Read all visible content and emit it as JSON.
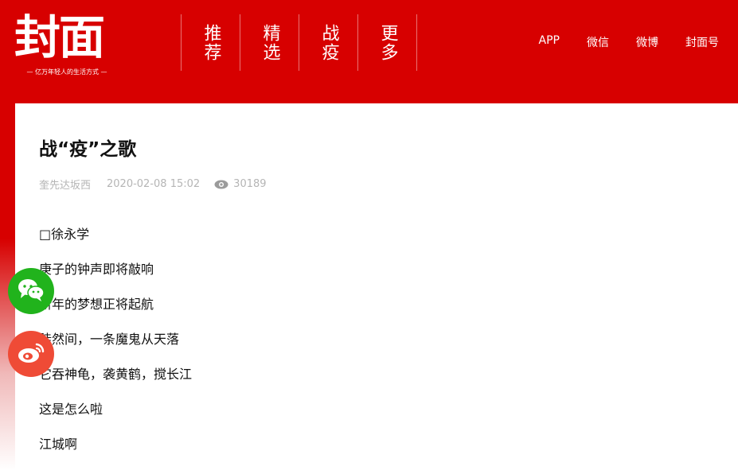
{
  "brand": {
    "logo_text": "封面",
    "slogan": "— 亿万年轻人的生活方式 —",
    "color": "#d70000"
  },
  "nav": {
    "items": [
      {
        "label": "推荐"
      },
      {
        "label": "精选"
      },
      {
        "label": "战疫"
      },
      {
        "label": "更多"
      }
    ],
    "right_links": [
      {
        "label": "APP"
      },
      {
        "label": "微信"
      },
      {
        "label": "微博"
      },
      {
        "label": "封面号"
      }
    ]
  },
  "article": {
    "title": "战“疫”之歌",
    "author": "奎先达坂西",
    "date": "2020-02-08 15:02",
    "views": "30189",
    "paragraphs": [
      "□徐永学",
      "庚子的钟声即将敲响",
      "新年的梦想正将起航",
      "陡然间，一条魔鬼从天落",
      "它吞神龟，袭黄鹤，搅长江",
      "这是怎么啦",
      "江城啊"
    ]
  },
  "share": {
    "wechat_icon": "wechat-icon",
    "weibo_icon": "weibo-icon",
    "wechat_color": "#21b31c",
    "weibo_color": "#ef4b36"
  }
}
